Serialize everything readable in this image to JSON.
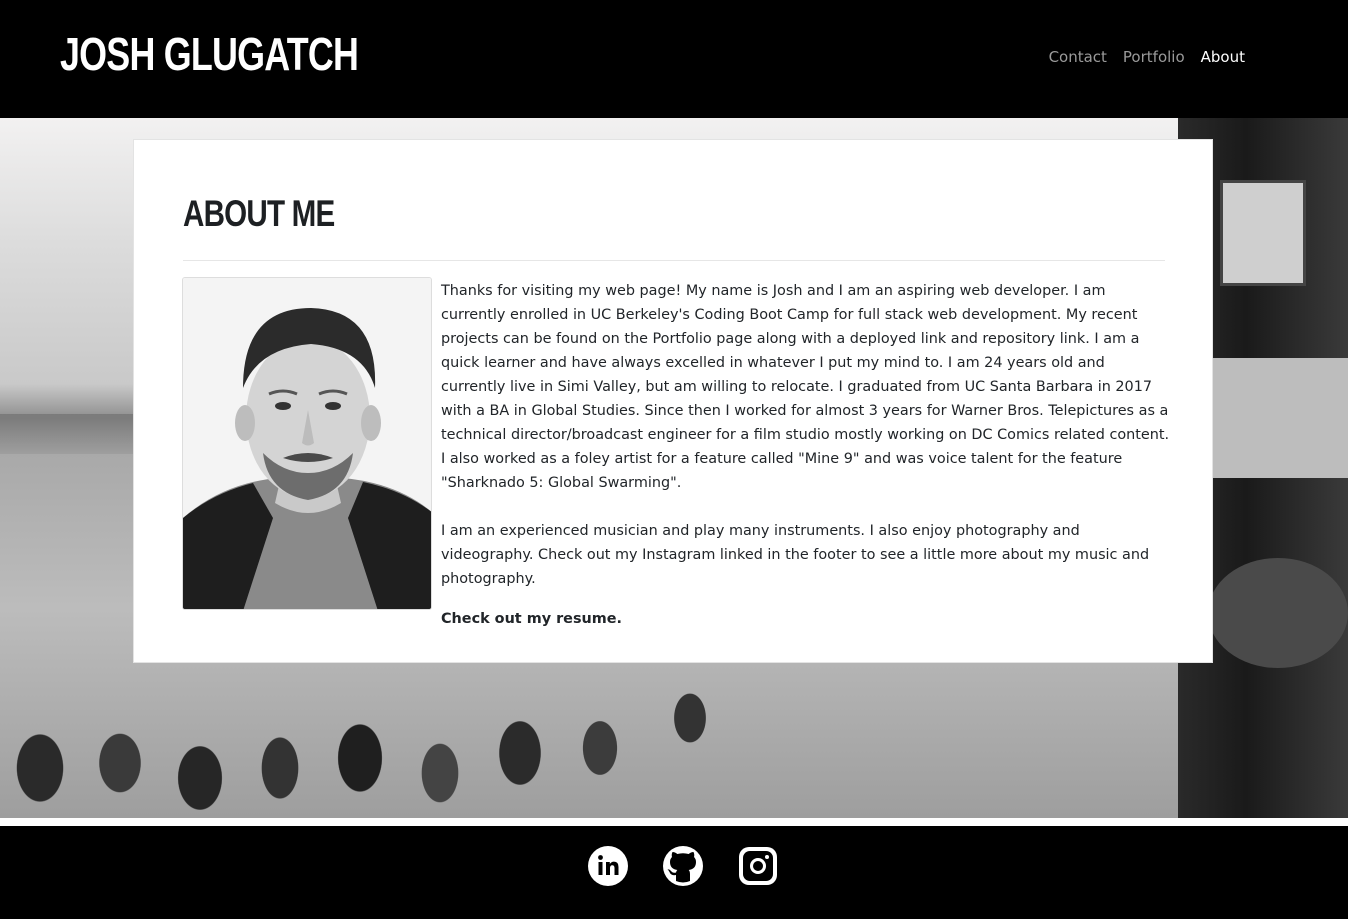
{
  "header": {
    "brand": "JOSH GLUGATCH",
    "nav": [
      {
        "label": "Contact",
        "active": false
      },
      {
        "label": "Portfolio",
        "active": false
      },
      {
        "label": "About",
        "active": true
      }
    ]
  },
  "about": {
    "title": "ABOUT ME",
    "paragraph1": "Thanks for visiting my web page! My name is Josh and I am an aspiring web developer. I am currently enrolled in UC Berkeley's Coding Boot Camp for full stack web development. My recent projects can be found on the Portfolio page along with a deployed link and repository link. I am a quick learner and have always excelled in whatever I put my mind to. I am 24 years old and currently live in Simi Valley, but am willing to relocate. I graduated from UC Santa Barbara in 2017 with a BA in Global Studies. Since then I worked for almost 3 years for Warner Bros. Telepictures as a technical director/broadcast engineer for a film studio mostly working on DC Comics related content. I also worked as a foley artist for a feature called \"Mine 9\" and was voice talent for the feature \"Sharknado 5: Global Swarming\".",
    "paragraph2": "I am an experienced musician and play many instruments. I also enjoy photography and videography. Check out my Instagram linked in the footer to see a little more about my music and photography.",
    "resume_link": "Check out my resume."
  },
  "footer": {
    "social_icons": [
      "linkedin-icon",
      "github-icon",
      "instagram-icon"
    ]
  },
  "colors": {
    "header_bg": "#000000",
    "nav_inactive": "#9a9a9a",
    "nav_active": "#ffffff",
    "card_bg": "#ffffff",
    "text": "#212529"
  }
}
